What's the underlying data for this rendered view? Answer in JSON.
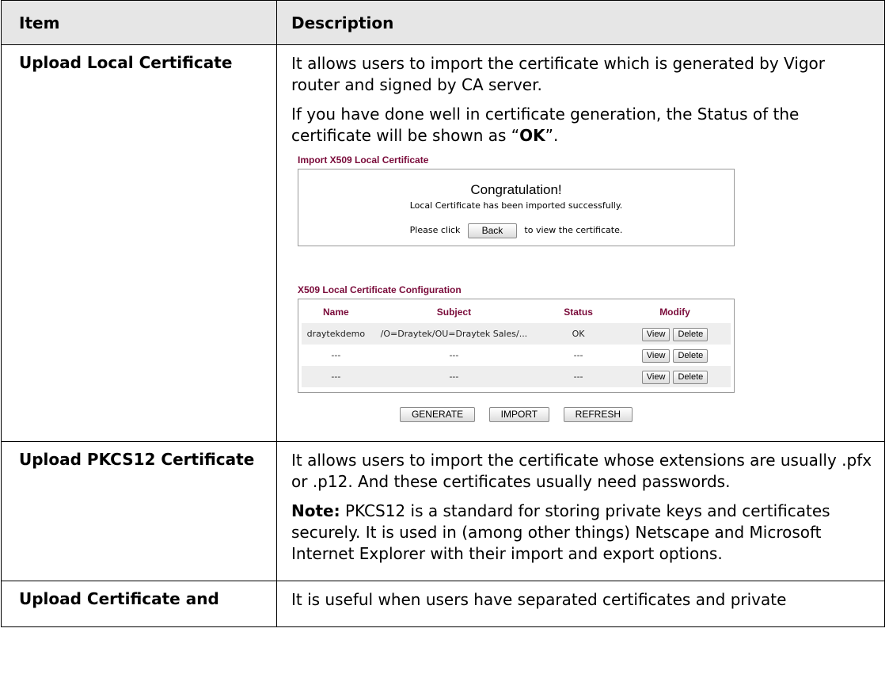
{
  "table": {
    "headers": {
      "item": "Item",
      "description": "Description"
    },
    "rows": [
      {
        "item": "Upload Local Certificate",
        "desc_1": "It allows users to import the certificate which is generated by Vigor router and signed by CA server.",
        "desc_2_prefix": "If you have done well in certificate generation, the Status of the certificate will be shown as “",
        "desc_2_bold": "OK",
        "desc_2_suffix": "”."
      },
      {
        "item": "Upload PKCS12 Certificate",
        "desc_1": "It allows users to import the certificate whose extensions are usually .pfx or .p12. And these certificates usually need passwords.",
        "note_label": "Note:",
        "note_text": " PKCS12 is a standard for storing private keys and certificates securely. It is used in (among other things) Netscape and Microsoft Internet Explorer with their import and export options."
      },
      {
        "item": "Upload Certificate and",
        "desc_1": "It is useful when users have separated certificates and private"
      }
    ]
  },
  "screenshot": {
    "import_title": "Import X509 Local Certificate",
    "congrats": "Congratulation!",
    "imported_msg": "Local Certificate has been imported successfully.",
    "click_prefix": "Please click",
    "back_label": "Back",
    "click_suffix": "to view the certificate.",
    "config_title": "X509 Local Certificate Configuration",
    "columns": {
      "name": "Name",
      "subject": "Subject",
      "status": "Status",
      "modify": "Modify"
    },
    "rows": [
      {
        "name": "draytekdemo",
        "subject": "/O=Draytek/OU=Draytek Sales/...",
        "status": "OK"
      },
      {
        "name": "---",
        "subject": "---",
        "status": "---"
      },
      {
        "name": "---",
        "subject": "---",
        "status": "---"
      }
    ],
    "view_label": "View",
    "delete_label": "Delete",
    "generate_label": "GENERATE",
    "import_label": "IMPORT",
    "refresh_label": "REFRESH",
    "accent_color": "#7a0b3a"
  }
}
